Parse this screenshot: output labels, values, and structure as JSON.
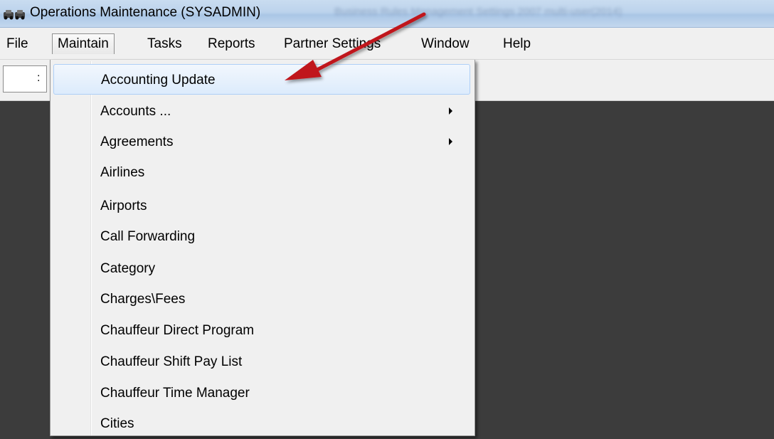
{
  "window": {
    "title": "Operations Maintenance (SYSADMIN)",
    "blurred_caption": "Business Rules Management Settings 2007 multi-user(2014)"
  },
  "menubar": {
    "items": [
      {
        "label": "File"
      },
      {
        "label": "Maintain",
        "active": true
      },
      {
        "label": "Tasks"
      },
      {
        "label": "Reports"
      },
      {
        "label": "Partner Settings"
      },
      {
        "label": "Window"
      },
      {
        "label": "Help"
      }
    ]
  },
  "toolbar": {
    "combo_text": ":"
  },
  "maintain_menu": {
    "items": [
      {
        "label": "Accounting Update",
        "highlighted": true
      },
      {
        "label": "Accounts ...",
        "submenu": true
      },
      {
        "label": "Agreements",
        "submenu": true
      },
      {
        "label": "Airlines"
      },
      {
        "label": "Airports"
      },
      {
        "label": "Call Forwarding"
      },
      {
        "label": "Category"
      },
      {
        "label": "Charges\\Fees"
      },
      {
        "label": "Chauffeur Direct Program"
      },
      {
        "label": "Chauffeur Shift Pay List"
      },
      {
        "label": "Chauffeur Time Manager"
      },
      {
        "label": "Cities"
      }
    ]
  },
  "colors": {
    "annotation_arrow": "#c0171c",
    "workspace": "#3c3c3c",
    "highlight": "#dcebfc"
  },
  "icons": {
    "app": "car-icon",
    "submenu": "submenu-arrow-icon",
    "annotation": "red-arrow-icon"
  }
}
